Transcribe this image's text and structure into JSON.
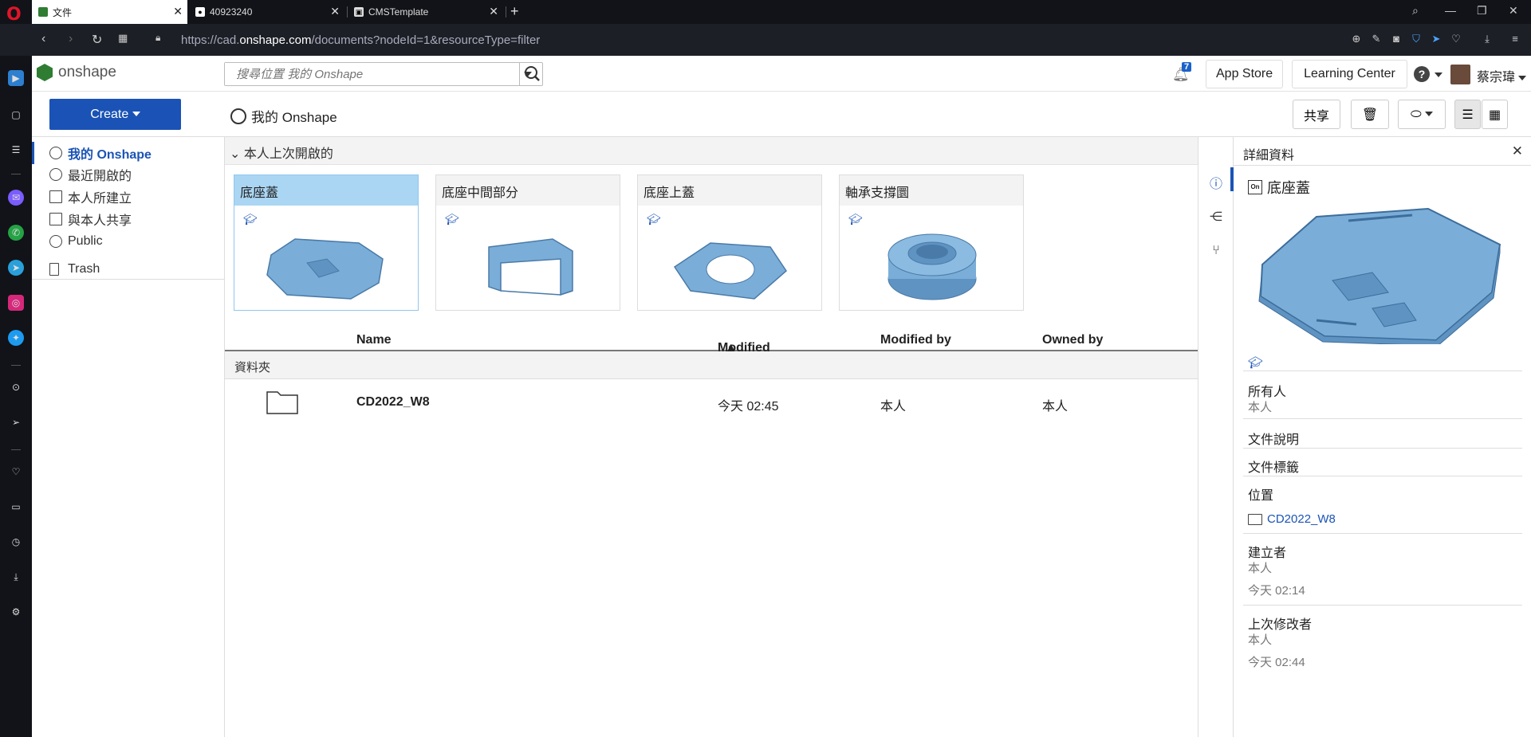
{
  "browser": {
    "tabs": [
      {
        "label": "文件",
        "favicon": "onshape-favicon"
      },
      {
        "label": "40923240",
        "favicon": "github-favicon"
      },
      {
        "label": "CMSTemplate",
        "favicon": "cms-favicon"
      }
    ],
    "url_prefix": "https://cad.",
    "url_domain": "onshape.com",
    "url_suffix": "/documents?nodeId=1&resourceType=filter"
  },
  "header": {
    "logo_text": "onshape",
    "search_placeholder": "搜尋位置 我的 Onshape",
    "notification_count": "7",
    "app_store": "App Store",
    "learning_center": "Learning Center",
    "user_name": "蔡宗瑋"
  },
  "toolbar": {
    "create": "Create",
    "breadcrumb": "我的 Onshape",
    "share": "共享"
  },
  "sidebar": {
    "items": [
      {
        "label": "我的 Onshape",
        "icon": "user-circle-icon",
        "selected": true
      },
      {
        "label": "最近開啟的",
        "icon": "clock-icon"
      },
      {
        "label": "本人所建立",
        "icon": "document-icon"
      },
      {
        "label": "與本人共享",
        "icon": "shared-user-icon"
      },
      {
        "label": "Public",
        "icon": "globe-icon"
      },
      {
        "label": "Trash",
        "icon": "trash-icon"
      }
    ]
  },
  "recent": {
    "header": "本人上次開啟的",
    "cards": [
      {
        "title": "底座蓋"
      },
      {
        "title": "底座中間部分"
      },
      {
        "title": "底座上蓋"
      },
      {
        "title": "軸承支撐圜"
      }
    ]
  },
  "list": {
    "columns": {
      "name": "Name",
      "modified": "Modified",
      "modified_by": "Modified by",
      "owned_by": "Owned by"
    },
    "sort_indicator": "▲",
    "group": "資料夾",
    "rows": [
      {
        "name": "CD2022_W8",
        "modified": "今天 02:45",
        "modified_by": "本人",
        "owned_by": "本人"
      }
    ]
  },
  "details": {
    "title": "詳細資料",
    "doc_name": "底座蓋",
    "owner_label": "所有人",
    "owner_value": "本人",
    "desc_label": "文件說明",
    "tags_label": "文件標籤",
    "location_label": "位置",
    "location_value": "CD2022_W8",
    "creator_label": "建立者",
    "creator_value": "本人",
    "created_time": "今天 02:14",
    "modifier_label": "上次修改者",
    "modifier_value": "本人",
    "modified_time": "今天 02:44"
  },
  "colors": {
    "accent": "#1a53b5",
    "part_fill": "#7aaed8",
    "selected_card": "#aad6f3"
  }
}
